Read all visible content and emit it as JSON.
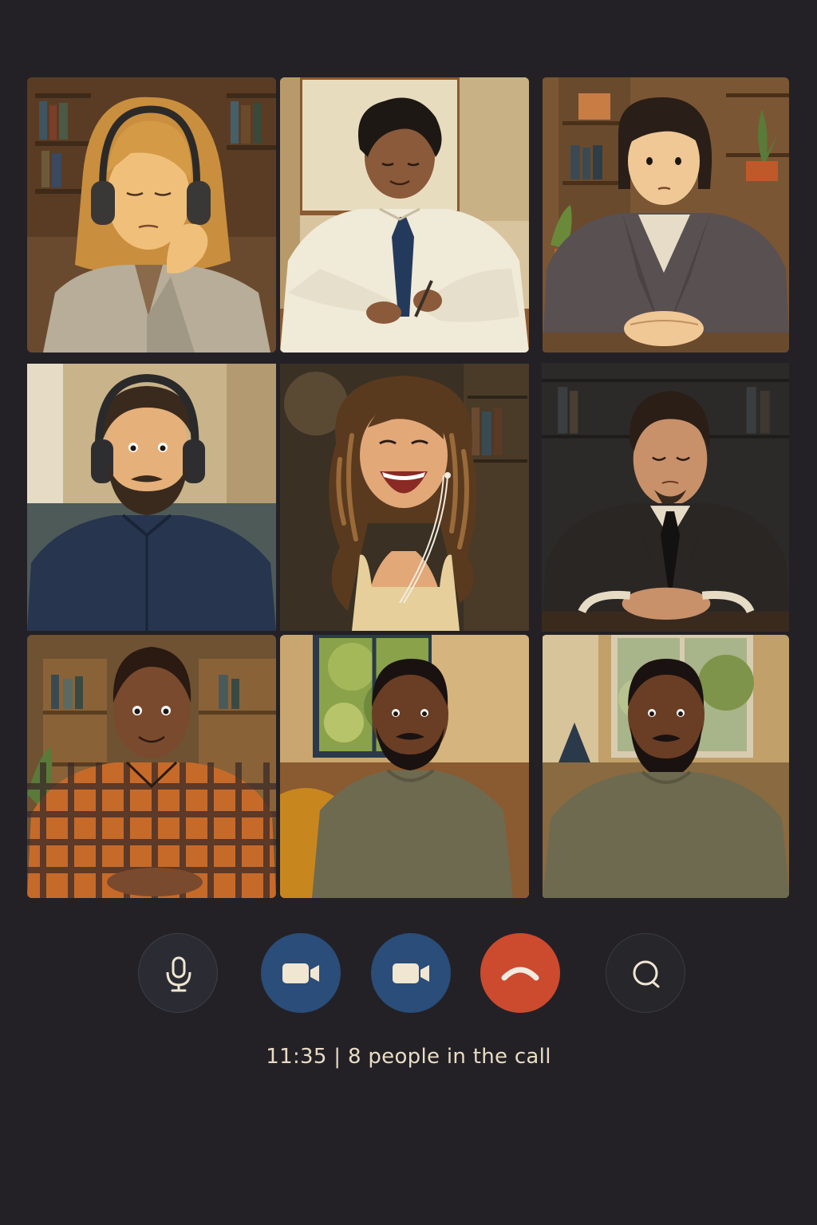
{
  "call": {
    "time": "11:35",
    "separator": "|",
    "participants_text": "8 people in the call"
  },
  "participants": [
    {
      "scene": "woman with blonde hair wearing headphones, eyes closed, bookshelf behind"
    },
    {
      "scene": "man in white shirt and navy tie writing on paper at desk"
    },
    {
      "scene": "woman with short dark bob in grey blazer, hands clasped, plant behind"
    },
    {
      "scene": "bearded man in navy shirt wearing headphones"
    },
    {
      "scene": "curly-haired woman laughing with earphones"
    },
    {
      "scene": "man in dark suit and black tie, eyes closed"
    },
    {
      "scene": "smiling man in orange plaid shirt, bookshelf behind"
    },
    {
      "scene": "man in olive t-shirt near window"
    },
    {
      "scene": "bearded man in olive t-shirt near window"
    }
  ],
  "controls": {
    "microphone": {
      "icon": "microphone-icon"
    },
    "camera_1": {
      "icon": "video-camera-icon"
    },
    "camera_2": {
      "icon": "video-camera-icon"
    },
    "end_call": {
      "icon": "phone-hangup-icon"
    },
    "chat": {
      "icon": "chat-bubble-icon"
    }
  },
  "colors": {
    "background": "#232126",
    "camera_button": "#2a4d79",
    "end_call_button": "#cc4a2e",
    "status_text": "#e9dcc4"
  }
}
